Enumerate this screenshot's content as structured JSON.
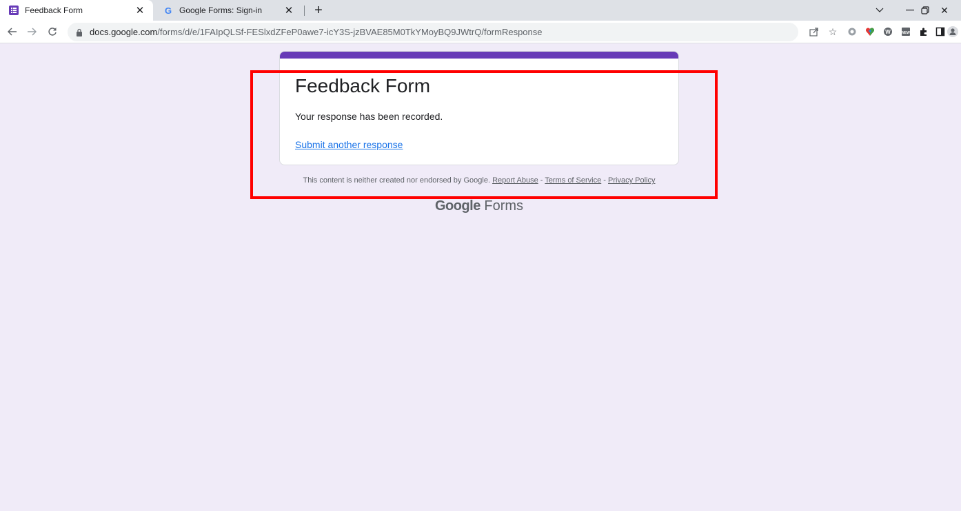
{
  "browser": {
    "tabs": [
      {
        "title": "Feedback Form",
        "active": true,
        "icon": "forms-icon"
      },
      {
        "title": "Google Forms: Sign-in",
        "active": false,
        "icon": "google-g-icon"
      }
    ],
    "url_domain": "docs.google.com",
    "url_path": "/forms/d/e/1FAIpQLSf-FESlxdZFeP0awe7-icY3S-jzBVAE85M0TkYMoyBQ9JWtrQ/formResponse"
  },
  "form": {
    "title": "Feedback Form",
    "confirmation": "Your response has been recorded.",
    "submit_another": "Submit another response",
    "accent_color": "#673ab7"
  },
  "footer": {
    "disclaimer": "This content is neither created nor endorsed by Google.",
    "report_abuse": "Report Abuse",
    "terms": "Terms of Service",
    "privacy": "Privacy Policy",
    "sep1": " - ",
    "sep2": " - ",
    "logo_google": "Google",
    "logo_forms": "Forms"
  },
  "annotation": {
    "highlight_color": "#ff0000"
  }
}
